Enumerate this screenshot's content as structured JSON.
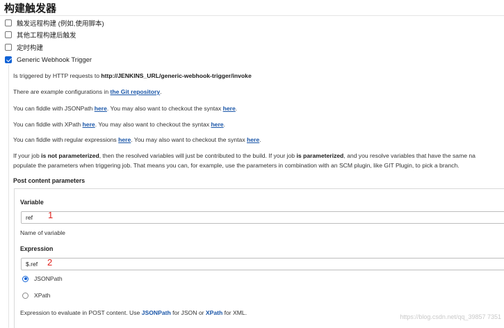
{
  "header": {
    "title": "构建触发器"
  },
  "triggers": [
    {
      "label": "触发远程构建 (例如,使用脚本)",
      "checked": false
    },
    {
      "label": "其他工程构建后触发",
      "checked": false
    },
    {
      "label": "定时构建",
      "checked": false
    },
    {
      "label": "Generic Webhook Trigger",
      "checked": true
    }
  ],
  "help": {
    "l1_prefix": "Is triggered by HTTP requests to ",
    "l1_url": "http://JENKINS_URL/generic-webhook-trigger/invoke",
    "l2_prefix": "There are example configurations in ",
    "l2_link": "the Git repository",
    "l2_suffix": ".",
    "l3_a": "You can fiddle with JSONPath ",
    "l3_link1": "here",
    "l3_b": ". You may also want to checkout the syntax ",
    "l3_link2": "here",
    "l3_c": ".",
    "l4_a": "You can fiddle with XPath ",
    "l4_link1": "here",
    "l4_b": ". You may also want to checkout the syntax ",
    "l4_link2": "here",
    "l4_c": ".",
    "l5_a": "You can fiddle with regular expressions ",
    "l5_link1": "here",
    "l5_b": ". You may also want to checkout the syntax ",
    "l5_link2": "here",
    "l5_c": ".",
    "l6_a": "If your job ",
    "l6_b": "is not parameterized",
    "l6_c": ", then the resolved variables will just be contributed to the build. If your job ",
    "l6_d": "is parameterized",
    "l6_e": ", and you resolve variables that have the same na",
    "l7": "populate the parameters when triggering job. That means you can, for example, use the parameters in combination with an SCM plugin, like GIT Plugin, to pick a branch."
  },
  "post_params": {
    "section_label": "Post content parameters",
    "variable_label": "Variable",
    "variable_value": "ref",
    "variable_annotation": "1",
    "variable_help": "Name of variable",
    "expression_label": "Expression",
    "expression_value": "$.ref",
    "expression_annotation": "2",
    "radio_jsonpath": "JSONPath",
    "radio_xpath": "XPath",
    "selected": "JSONPath",
    "expr_help_a": "Expression to evaluate in POST content. Use ",
    "expr_help_link1": "JSONPath",
    "expr_help_b": " for JSON or ",
    "expr_help_link2": "XPath",
    "expr_help_c": " for XML."
  },
  "watermark": "https://blog.csdn.net/qq_39857 7351",
  "colors": {
    "link": "#1a56a8",
    "accent": "#0f62d6",
    "annotation": "#e0201b"
  }
}
